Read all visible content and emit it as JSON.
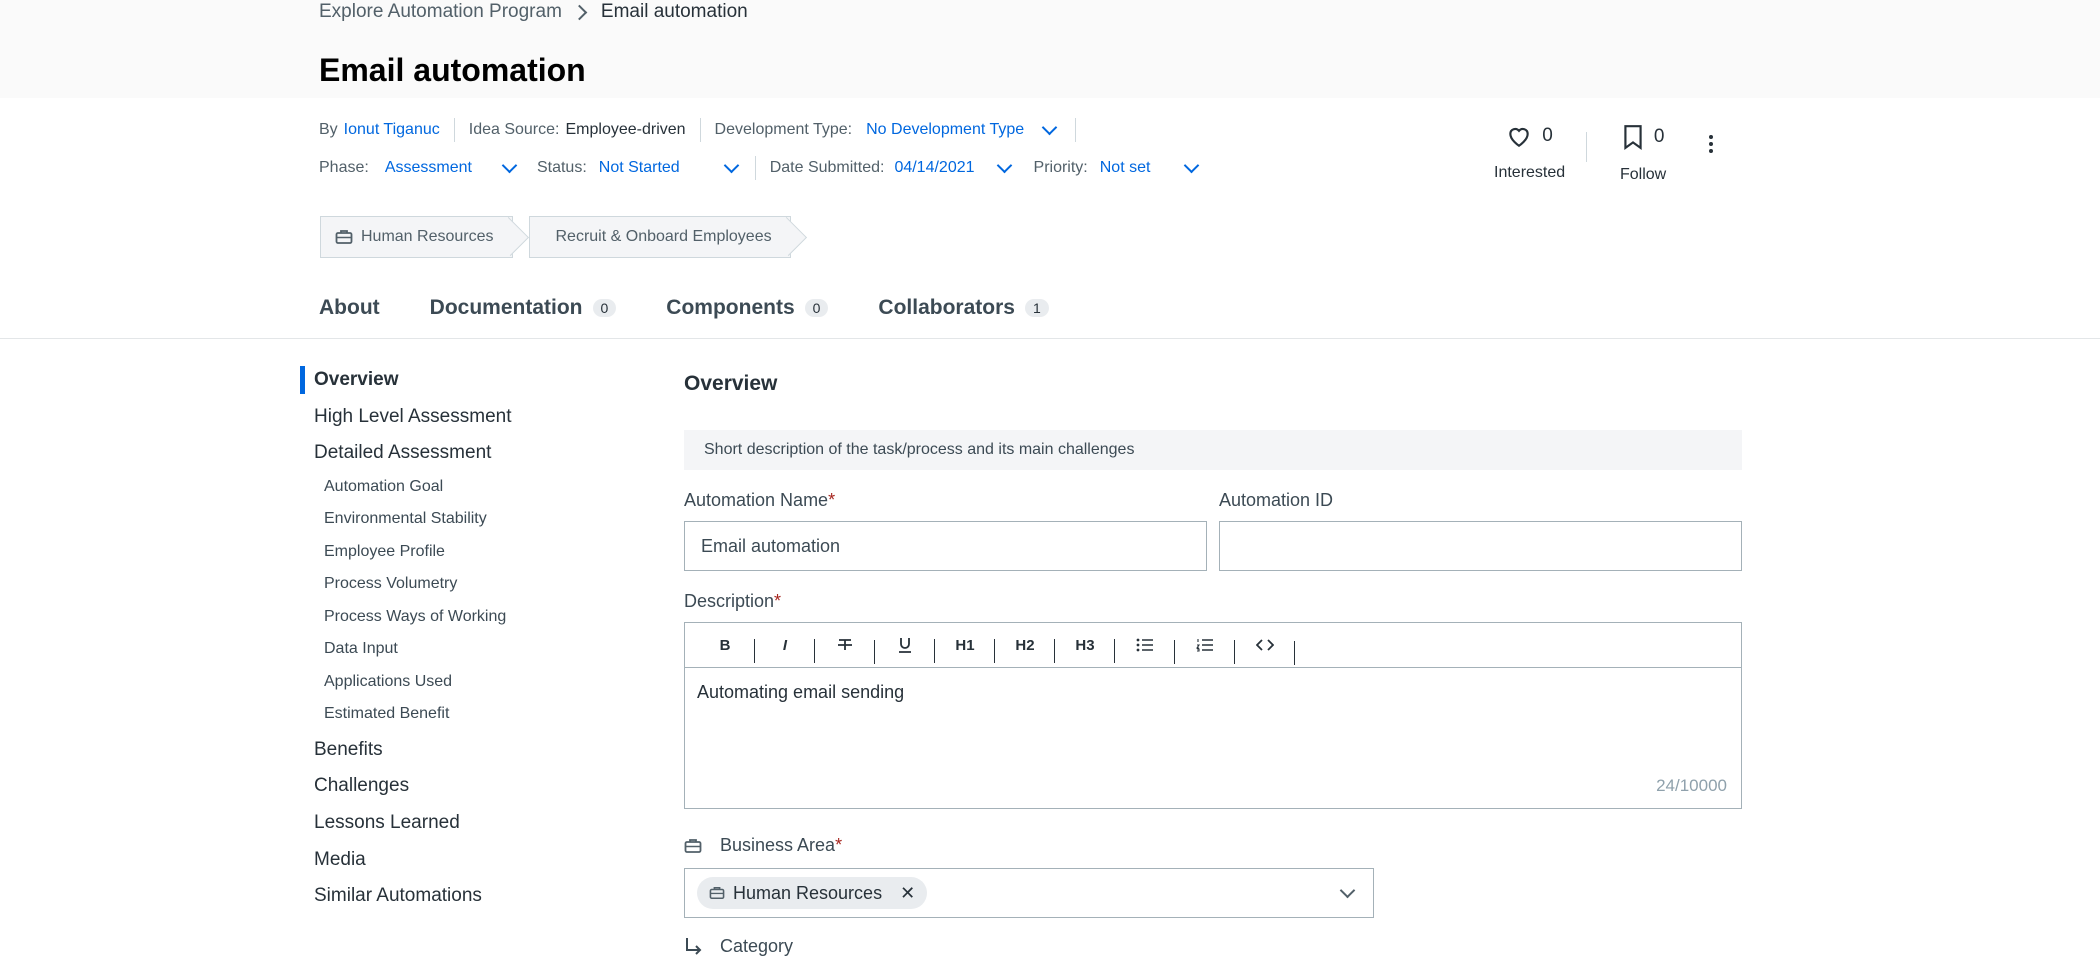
{
  "breadcrumb": {
    "parent": "Explore Automation Program",
    "current": "Email automation"
  },
  "page": {
    "title": "Email automation"
  },
  "meta": {
    "by_label": "By",
    "by_value": "Ionut Tiganuc",
    "idea_source_label": "Idea Source:",
    "idea_source_value": "Employee-driven",
    "dev_type_label": "Development Type:",
    "dev_type_value": "No Development Type",
    "phase_label": "Phase:",
    "phase_value": "Assessment",
    "status_label": "Status:",
    "status_value": "Not Started",
    "date_label": "Date Submitted:",
    "date_value": "04/14/2021",
    "priority_label": "Priority:",
    "priority_value": "Not set"
  },
  "stats": {
    "interested_count": "0",
    "interested_label": "Interested",
    "follow_count": "0",
    "follow_label": "Follow"
  },
  "tags": [
    "Human Resources",
    "Recruit & Onboard Employees"
  ],
  "tabs": [
    {
      "label": "About"
    },
    {
      "label": "Documentation",
      "count": "0"
    },
    {
      "label": "Components",
      "count": "0"
    },
    {
      "label": "Collaborators",
      "count": "1"
    }
  ],
  "sidebar": {
    "items": [
      "Overview",
      "High Level Assessment",
      "Detailed Assessment",
      "Automation Goal",
      "Environmental Stability",
      "Employee Profile",
      "Process Volumetry",
      "Process Ways of Working",
      "Data Input",
      "Applications Used",
      "Estimated Benefit",
      "Benefits",
      "Challenges",
      "Lessons Learned",
      "Media",
      "Similar Automations"
    ]
  },
  "main": {
    "section_title": "Overview",
    "helper_text": "Short description of the task/process and its main challenges",
    "automation_name_label": "Automation Name",
    "automation_name_value": "Email automation",
    "automation_id_label": "Automation ID",
    "automation_id_value": "",
    "description_label": "Description",
    "description_value": "Automating email sending",
    "description_counter": "24/10000",
    "toolbar": {
      "bold": "B",
      "italic": "I",
      "h1": "H1",
      "h2": "H2",
      "h3": "H3"
    },
    "business_area_label": "Business Area",
    "business_area_chip": "Human Resources",
    "category_label": "Category",
    "required_mark": "*"
  },
  "colors": {
    "link": "#0067df",
    "required": "#a6251e",
    "active_bar": "#0067df"
  }
}
